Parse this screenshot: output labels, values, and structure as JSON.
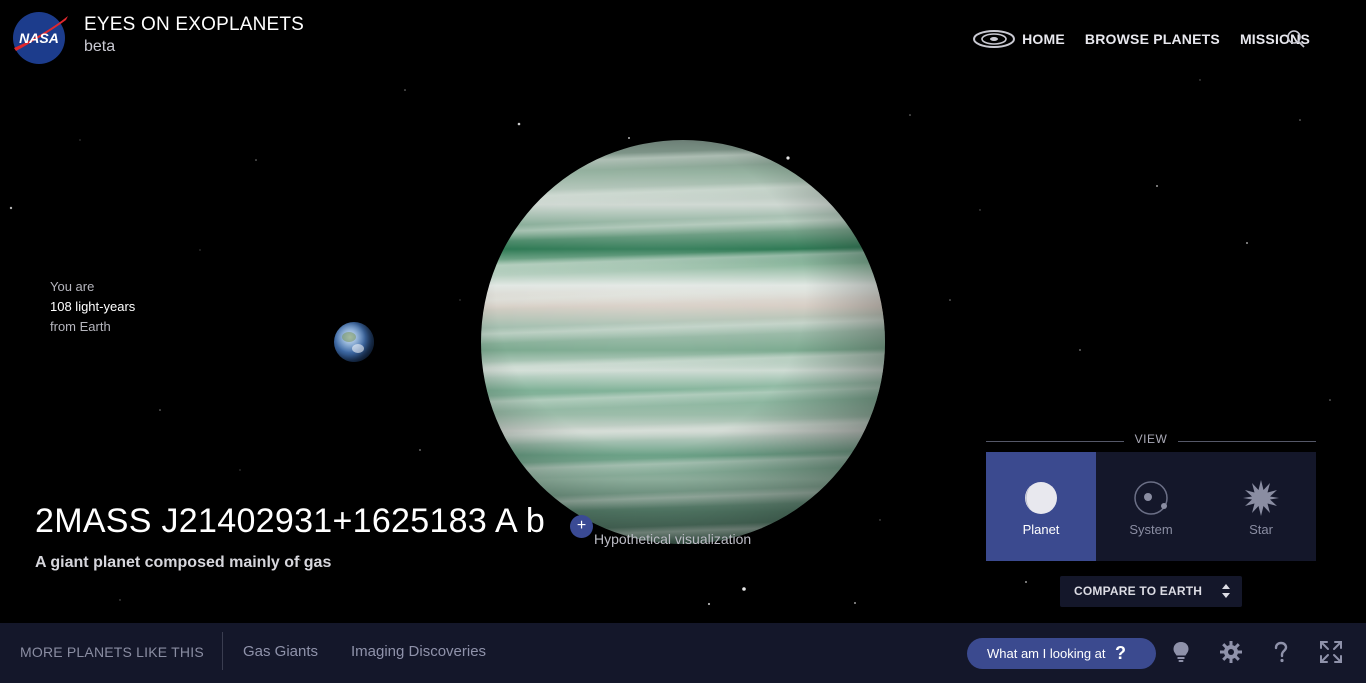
{
  "header": {
    "title": "EYES ON EXOPLANETS",
    "subtitle": "beta",
    "logo_text": "NASA"
  },
  "nav": {
    "items": [
      {
        "label": "HOME"
      },
      {
        "label": "BROWSE PLANETS"
      },
      {
        "label": "MISSIONS"
      }
    ],
    "icons": [
      "galaxy-icon",
      "search-icon"
    ]
  },
  "distance": {
    "prefix": "You are",
    "value": "108 light-years",
    "suffix": "from Earth"
  },
  "planet": {
    "name": "2MASS J21402931+1625183 A b",
    "add_symbol": "+",
    "visualization_note": "Hypothetical visualization",
    "description": "A giant planet composed mainly of gas"
  },
  "view": {
    "label": "VIEW",
    "options": [
      {
        "label": "Planet",
        "icon": "planet-icon",
        "active": true
      },
      {
        "label": "System",
        "icon": "system-icon",
        "active": false
      },
      {
        "label": "Star",
        "icon": "star-icon",
        "active": false
      }
    ]
  },
  "compare": {
    "label": "COMPARE TO EARTH"
  },
  "bottom_bar": {
    "more_label": "MORE PLANETS LIKE THIS",
    "links": [
      {
        "label": "Gas Giants"
      },
      {
        "label": "Imaging Discoveries"
      }
    ],
    "help_button": {
      "label": "What am I looking at",
      "symbol": "?"
    },
    "tools": [
      "lightbulb-icon",
      "gear-icon",
      "help-icon",
      "fullscreen-icon"
    ]
  },
  "colors": {
    "accent": "#3b4a8f",
    "panel_bg": "#14172a",
    "background": "#000000"
  }
}
